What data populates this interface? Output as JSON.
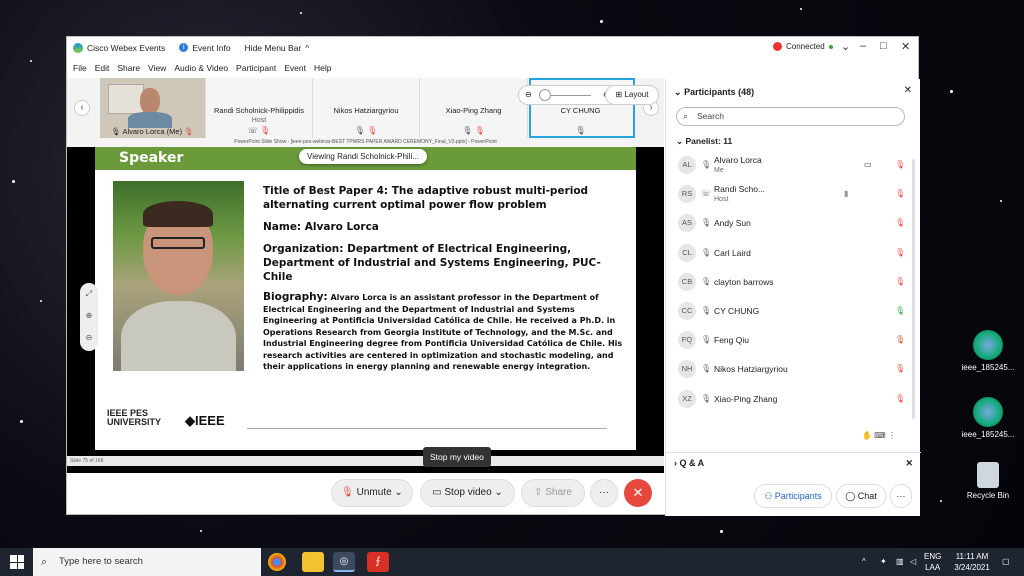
{
  "window": {
    "app_title": "Cisco Webex Events",
    "event_info": "Event Info",
    "hide_menu": "Hide Menu Bar",
    "status": "Connected"
  },
  "menu": [
    "File",
    "Edit",
    "Share",
    "View",
    "Audio & Video",
    "Participant",
    "Event",
    "Help"
  ],
  "thumbs": [
    {
      "name": "Alvaro Lorca",
      "sub": "(Me)"
    },
    {
      "name": "Randi Scholnick-Philippidis",
      "sub": "Host"
    },
    {
      "name": "Nikos Hatziargyriou",
      "sub": ""
    },
    {
      "name": "Xiao-Ping Zhang",
      "sub": ""
    },
    {
      "name": "CY CHUNG",
      "sub": ""
    }
  ],
  "layout_label": "Layout",
  "viewing_label": "Viewing Randi Scholnick-Phili...",
  "ppt_title": "PowerPoint Slide Show - [ieee-pes-webinar-BEST TPWRS PAPER AWARD CEREMONY_Final_V3.pptx] - PowerPoint",
  "ppt_status": "Slide 75 of 168",
  "slide": {
    "heading": "Speaker",
    "title": "Title of Best Paper 4: The adaptive robust multi-period alternating current optimal power flow problem",
    "name": "Name: Alvaro Lorca",
    "org": "Organization: Department of Electrical Engineering, Department of Industrial and Systems Engineering, PUC-Chile",
    "bio_label": "Biography:",
    "bio_text": "Alvaro Lorca is an assistant professor in the Department of Electrical Engineering and the Department of Industrial and Systems Engineering at Pontificia Universidad Católica de Chile. He received a Ph.D. in Operations Research from Georgia Institute of Technology, and the M.Sc. and Industrial Engineering degree from Pontificia Universidad Católica de Chile. His research activities are centered in optimization and stochastic modeling, and their applications in energy planning and renewable energy integration.",
    "logo1": "IEEE PES UNIVERSITY",
    "logo2": "◆IEEE"
  },
  "tooltip": "Stop my video",
  "controls": {
    "unmute": "Unmute",
    "video": "Stop video",
    "share": "Share",
    "more": "···"
  },
  "panel": {
    "title": "Participants (48)",
    "search_placeholder": "Search",
    "panelist_header": "Panelist: 11",
    "qa": "Q & A",
    "participants_btn": "Participants",
    "chat_btn": "Chat"
  },
  "participants": [
    {
      "initials": "AL",
      "name": "Alvaro Lorca",
      "sub": "Me"
    },
    {
      "initials": "RS",
      "name": "Randi Scho...",
      "sub": "Host"
    },
    {
      "initials": "AS",
      "name": "Andy Sun",
      "sub": ""
    },
    {
      "initials": "CL",
      "name": "Carl Laird",
      "sub": ""
    },
    {
      "initials": "CB",
      "name": "clayton barrows",
      "sub": ""
    },
    {
      "initials": "CC",
      "name": "CY CHUNG",
      "sub": ""
    },
    {
      "initials": "FQ",
      "name": "Feng Qiu",
      "sub": ""
    },
    {
      "initials": "NH",
      "name": "Nikos Hatziargyriou",
      "sub": ""
    },
    {
      "initials": "XZ",
      "name": "Xiao-Ping Zhang",
      "sub": ""
    }
  ],
  "desktop": [
    "ieee_185245...",
    "ieee_185245...",
    "Recycle Bin"
  ],
  "taskbar": {
    "search": "Type here to search",
    "lang1": "ENG",
    "lang2": "LAA",
    "time": "11:11 AM",
    "date": "3/24/2021"
  }
}
